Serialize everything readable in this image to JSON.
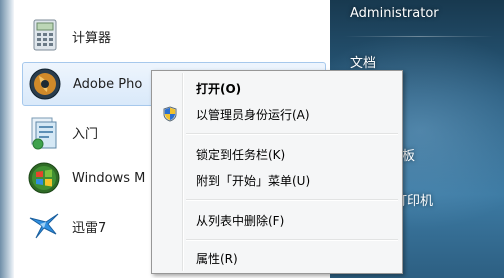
{
  "start_menu": {
    "programs": [
      {
        "label": "计算器",
        "icon": "calculator-icon"
      },
      {
        "label": "Adobe Pho",
        "icon": "adobe-photoshop-icon"
      },
      {
        "label": "入门",
        "icon": "getting-started-icon"
      },
      {
        "label": "Windows M",
        "icon": "windows-media-icon"
      },
      {
        "label": "迅雷7",
        "icon": "thunder-bird-icon"
      }
    ],
    "right_pane": {
      "user": "Administrator",
      "documents": "文档",
      "partial_1": "板",
      "partial_2": "打印机"
    }
  },
  "context_menu": {
    "items": [
      {
        "label": "打开(O)",
        "bold": true
      },
      {
        "label": "以管理员身份运行(A)",
        "icon": "uac-shield-icon"
      },
      {
        "label": "锁定到任务栏(K)"
      },
      {
        "label": "附到「开始」菜单(U)"
      },
      {
        "label": "从列表中删除(F)"
      },
      {
        "label": "属性(R)"
      }
    ]
  },
  "colors": {
    "menu_bg": "#f5f6f7",
    "hover_bg": "#d9e9fa",
    "right_pane_top": "#18394f",
    "right_pane_bottom": "#2d5f82"
  }
}
